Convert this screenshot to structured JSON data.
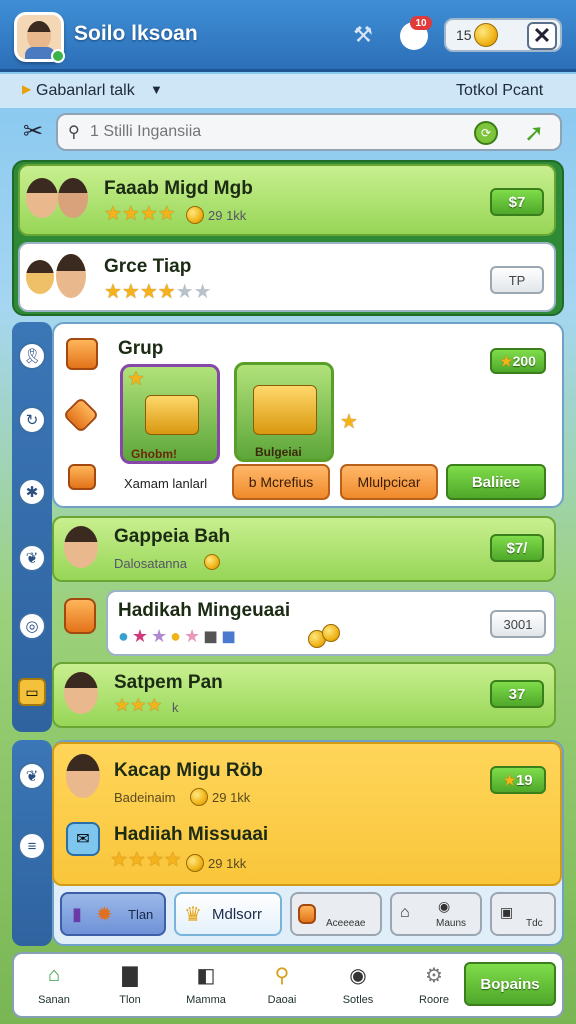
{
  "header": {
    "app_name": "Soilo lksoan",
    "coin_amount": "15",
    "badge": "10",
    "close_label": "✕"
  },
  "subheader": {
    "dropdown_label": "Gabanlarl talk",
    "right_label": "Totkol Pcant"
  },
  "search": {
    "placeholder": "1 Stilli Ingansiia"
  },
  "top_list": [
    {
      "title": "Faaab Migd Mgb",
      "sub": "29 1kk",
      "stars": 4,
      "button": "$7",
      "button_style": "green"
    },
    {
      "title": "Grce Tiap",
      "sub": "",
      "stars": 5,
      "stars_filled": 4,
      "button": "TP",
      "button_style": "white"
    }
  ],
  "group": {
    "title": "Grup",
    "price_badge": "200",
    "prize1_label": "Ghobm!",
    "prize2_label": "Bulgeiai",
    "caption": "Xamam lanlarl",
    "buttons": [
      "b Mcrefius",
      "Mlulpcicar",
      "Baliiee"
    ]
  },
  "mid_list": [
    {
      "title": "Gappeia Bah",
      "sub": "Dalosatanna",
      "button": "$7/"
    },
    {
      "title": "Hadikah Mingeuaai",
      "sub": "",
      "button": "3001"
    },
    {
      "title": "Satpem Pan",
      "sub": "k",
      "button": "37"
    }
  ],
  "yellow_section": {
    "item1": {
      "title": "Kacap Migu Röb",
      "sub": "Badeinaim",
      "coins": "29 1kk",
      "badge": "19"
    },
    "item2": {
      "title": "Hadiiah Missuaai",
      "sub": "29 1kk"
    }
  },
  "tabs": [
    "Tlan",
    "Mdlsorr",
    "Aceeeae",
    "Mauns",
    "Tdc"
  ],
  "nav": {
    "items": [
      "Sanan",
      "Tlon",
      "Mamma",
      "Daoai",
      "Sotles",
      "Roore"
    ],
    "cta": "Bopains"
  },
  "colors": {
    "accent": "#2c6fb8",
    "green": "#97d657",
    "yellow": "#f9c63b"
  }
}
